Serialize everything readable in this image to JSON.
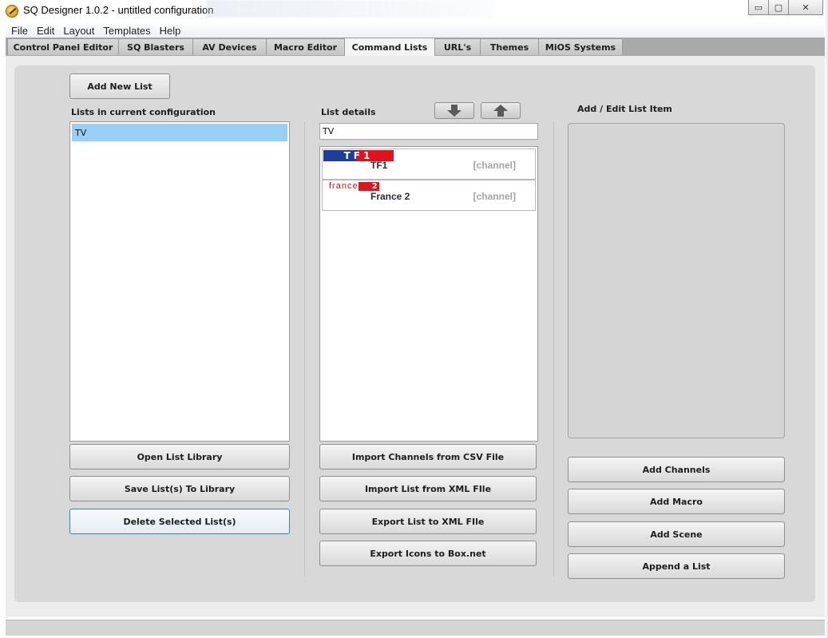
{
  "window": {
    "title": "SQ Designer 1.0.2 - untitled configuration",
    "controls": {
      "minimize": "▭",
      "maximize": "▢",
      "close": "✕"
    }
  },
  "menu": [
    "File",
    "Edit",
    "Layout",
    "Templates",
    "Help"
  ],
  "tabs": [
    {
      "label": "Control Panel Editor"
    },
    {
      "label": "SQ Blasters"
    },
    {
      "label": "AV Devices"
    },
    {
      "label": "Macro Editor"
    },
    {
      "label": "Command Lists",
      "active": true
    },
    {
      "label": "URL's"
    },
    {
      "label": "Themes"
    },
    {
      "label": "MiOS Systems"
    }
  ],
  "left": {
    "add_new_list": "Add New List",
    "lists_label": "Lists in current configuration",
    "lists": [
      "TV"
    ],
    "open_library": "Open List Library",
    "save_to_library": "Save List(s) To Library",
    "delete_selected": "Delete Selected List(s)"
  },
  "middle": {
    "list_details_label": "List details",
    "list_name_value": "TV",
    "down_icon": "arrow-down-icon",
    "up_icon": "arrow-up-icon",
    "channels": [
      {
        "name": "TF1",
        "type": "[channel]",
        "logo": "TF1"
      },
      {
        "name": "France 2",
        "type": "[channel]",
        "logo_text": "france",
        "logo_mark": "2"
      }
    ],
    "import_csv": "Import Channels from CSV File",
    "import_xml": "Import List from XML FIle",
    "export_xml": "Export List to XML FIle",
    "export_icons": "Export Icons to Box.net"
  },
  "right": {
    "add_edit_label": "Add / Edit List Item",
    "add_channels": "Add Channels",
    "add_macro": "Add Macro",
    "add_scene": "Add Scene",
    "append_list": "Append a List"
  },
  "colors": {
    "selected_row": "#99cff7",
    "tf1_blue": "#1f3d99",
    "tf1_red": "#e0121b",
    "focus_border": "#3d7fb8"
  }
}
